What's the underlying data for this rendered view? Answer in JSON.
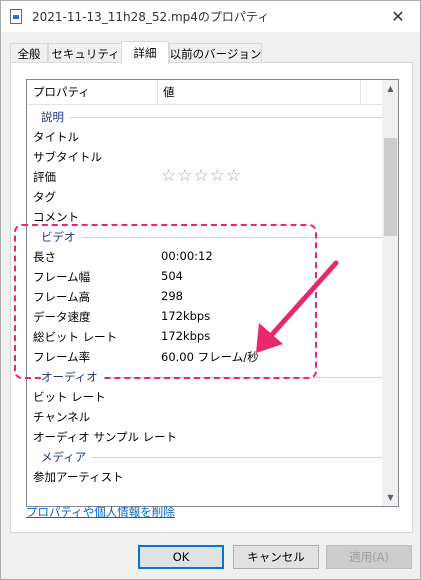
{
  "window": {
    "title": "2021-11-13_11h28_52.mp4のプロパティ",
    "close_glyph": "✕"
  },
  "tabs": [
    {
      "label": "全般"
    },
    {
      "label": "セキュリティ"
    },
    {
      "label": "詳細"
    },
    {
      "label": "以前のバージョン"
    }
  ],
  "list": {
    "headers": {
      "property": "プロパティ",
      "value": "値"
    },
    "groups": {
      "description": {
        "label": "説明"
      },
      "video": {
        "label": "ビデオ"
      },
      "audio": {
        "label": "オーディオ"
      },
      "media": {
        "label": "メディア"
      }
    },
    "description_rows": [
      {
        "prop": "タイトル",
        "val": ""
      },
      {
        "prop": "サブタイトル",
        "val": ""
      },
      {
        "prop": "評価",
        "val": "☆☆☆☆☆"
      },
      {
        "prop": "タグ",
        "val": ""
      },
      {
        "prop": "コメント",
        "val": ""
      }
    ],
    "video_rows": [
      {
        "prop": "長さ",
        "val": "00:00:12"
      },
      {
        "prop": "フレーム幅",
        "val": "504"
      },
      {
        "prop": "フレーム高",
        "val": "298"
      },
      {
        "prop": "データ速度",
        "val": "172kbps"
      },
      {
        "prop": "総ビット レート",
        "val": "172kbps"
      },
      {
        "prop": "フレーム率",
        "val": "60.00 フレーム/秒"
      }
    ],
    "audio_rows": [
      {
        "prop": "ビット レート",
        "val": ""
      },
      {
        "prop": "チャンネル",
        "val": ""
      },
      {
        "prop": "オーディオ サンプル レート",
        "val": ""
      }
    ],
    "media_rows": [
      {
        "prop": "参加アーティスト",
        "val": ""
      }
    ],
    "rating_stars": 0
  },
  "links": {
    "remove_properties": "プロパティや個人情報を削除"
  },
  "buttons": {
    "ok": "OK",
    "cancel": "キャンセル",
    "apply": "適用(A)"
  },
  "colors": {
    "annotation": "#e8286e",
    "link": "#0066cc",
    "group_label": "#1e3287",
    "ok_border": "#0078d7"
  },
  "icons": {
    "file": "file-icon",
    "close": "close-icon",
    "scroll_up": "scroll-up-icon",
    "scroll_down": "scroll-down-icon",
    "annotation_arrow": "arrow-icon"
  }
}
